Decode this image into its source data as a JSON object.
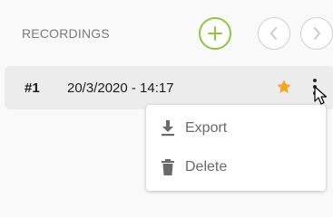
{
  "header": {
    "title": "RECORDINGS",
    "add_icon": "plus-icon",
    "prev_icon": "chevron-left-icon",
    "next_icon": "chevron-right-icon"
  },
  "recordings": [
    {
      "number": "#1",
      "datetime": "20/3/2020 - 14:17",
      "starred": true,
      "star_color": "#f5a623"
    }
  ],
  "context_menu": {
    "items": [
      {
        "label": "Export",
        "icon": "download-icon"
      },
      {
        "label": "Delete",
        "icon": "trash-icon"
      }
    ]
  },
  "colors": {
    "accent": "#8dc63f",
    "star": "#f5a623",
    "row_bg": "#ececec",
    "text_muted": "#7a7a7a"
  }
}
